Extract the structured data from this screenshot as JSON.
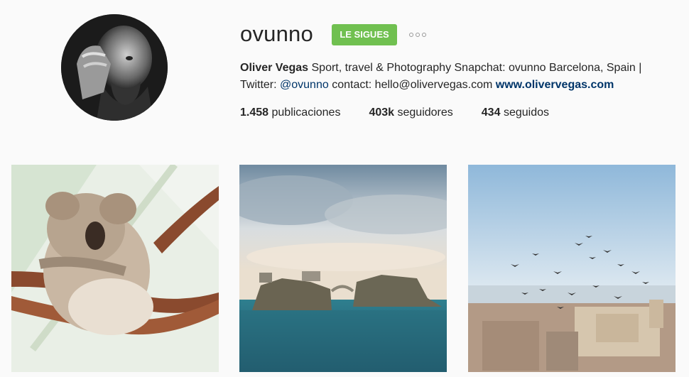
{
  "profile": {
    "username": "ovunno",
    "follow_label": "LE SIGUES",
    "more_icon": "ellipsis-icon",
    "full_name": "Oliver Vegas",
    "bio_line1": " Sport, travel & Photography Snapchat: ovunno Barcelona, Spain |",
    "bio_line2_prefix": "Twitter: ",
    "twitter_handle": "@ovunno",
    "bio_line2_mid": " contact: hello@olivervegas.com ",
    "website": "www.olivervegas.com"
  },
  "stats": {
    "posts_count": "1.458",
    "posts_label": "publicaciones",
    "followers_count": "403k",
    "followers_label": "seguidores",
    "following_count": "434",
    "following_label": "seguidos"
  },
  "colors": {
    "follow_button": "#70c050",
    "link": "#003569"
  }
}
